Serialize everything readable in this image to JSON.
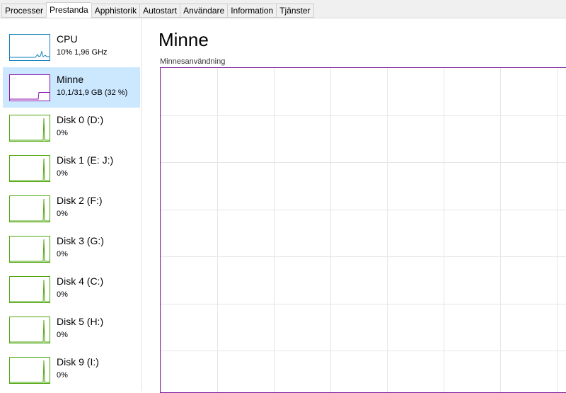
{
  "tabs": [
    {
      "label": "Processer",
      "active": false
    },
    {
      "label": "Prestanda",
      "active": true
    },
    {
      "label": "Apphistorik",
      "active": false
    },
    {
      "label": "Autostart",
      "active": false
    },
    {
      "label": "Användare",
      "active": false
    },
    {
      "label": "Information",
      "active": false
    },
    {
      "label": "Tjänster",
      "active": false
    }
  ],
  "sidebar": {
    "items": [
      {
        "title": "CPU",
        "subtitle": "10% 1,96 GHz",
        "color": "#117dbb",
        "kind": "cpu"
      },
      {
        "title": "Minne",
        "subtitle": "10,1/31,9 GB (32 %)",
        "color": "#8b12ae",
        "kind": "memory",
        "selected": true,
        "usage_percent": 32
      },
      {
        "title": "Disk 0 (D:)",
        "subtitle": "0%",
        "color": "#4da60c",
        "kind": "disk"
      },
      {
        "title": "Disk 1 (E: J:)",
        "subtitle": "0%",
        "color": "#4da60c",
        "kind": "disk"
      },
      {
        "title": "Disk 2 (F:)",
        "subtitle": "0%",
        "color": "#4da60c",
        "kind": "disk"
      },
      {
        "title": "Disk 3 (G:)",
        "subtitle": "0%",
        "color": "#4da60c",
        "kind": "disk"
      },
      {
        "title": "Disk 4 (C:)",
        "subtitle": "0%",
        "color": "#4da60c",
        "kind": "disk"
      },
      {
        "title": "Disk 5 (H:)",
        "subtitle": "0%",
        "color": "#4da60c",
        "kind": "disk"
      },
      {
        "title": "Disk 9 (I:)",
        "subtitle": "0%",
        "color": "#4da60c",
        "kind": "disk"
      }
    ]
  },
  "main": {
    "title": "Minne",
    "chart_label": "Minnesanvändning",
    "accent_color": "#7a1a9a",
    "grid_color": "#e6e6e6"
  }
}
